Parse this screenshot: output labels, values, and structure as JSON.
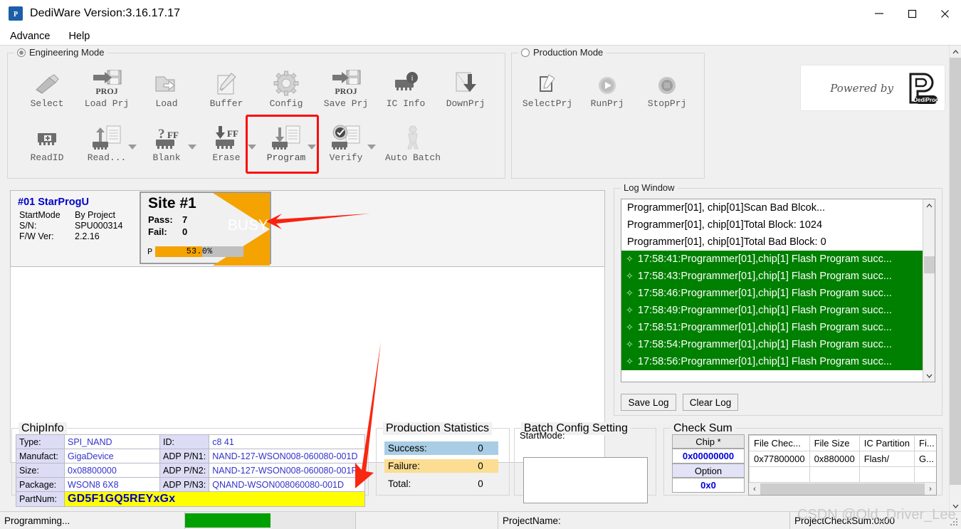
{
  "window": {
    "title": "DediWare  Version:3.16.17.17",
    "app_icon": "P",
    "minimize": "—",
    "maximize": "□",
    "close": "✕"
  },
  "menubar": {
    "items": [
      "Advance",
      "Help"
    ]
  },
  "engineering_mode": {
    "legend": "Engineering Mode",
    "selected": true,
    "buttons": [
      {
        "label": "Select",
        "icon": "select-icon"
      },
      {
        "label": "Load Prj",
        "icon": "load-prj-icon"
      },
      {
        "label": "Load",
        "icon": "load-icon"
      },
      {
        "label": "Buffer",
        "icon": "buffer-icon"
      },
      {
        "label": "Config",
        "icon": "config-gear-icon"
      },
      {
        "label": "Save Prj",
        "icon": "save-prj-icon"
      },
      {
        "label": "IC Info",
        "icon": "ic-info-icon"
      },
      {
        "label": "DownPrj",
        "icon": "down-prj-icon"
      },
      {
        "label": "ReadID",
        "icon": "read-id-icon"
      },
      {
        "label": "Read...",
        "icon": "read-icon"
      },
      {
        "label": "Blank",
        "icon": "blank-check-icon"
      },
      {
        "label": "Erase",
        "icon": "erase-icon"
      },
      {
        "label": "Program",
        "icon": "program-icon"
      },
      {
        "label": "Verify",
        "icon": "verify-icon"
      },
      {
        "label": "Auto Batch",
        "icon": "auto-batch-icon"
      }
    ],
    "highlighted_button": "Program"
  },
  "production_mode": {
    "legend": "Production Mode",
    "selected": false,
    "buttons": [
      {
        "label": "SelectPrj",
        "icon": "select-prj-icon"
      },
      {
        "label": "RunPrj",
        "icon": "run-prj-icon"
      },
      {
        "label": "StopPrj",
        "icon": "stop-prj-icon"
      }
    ]
  },
  "powered_by": {
    "text": "Powered by",
    "logo_text": "DediProg"
  },
  "site_panel": {
    "programmer_title": "#01 StarProgU",
    "rows": [
      {
        "key": "StartMode",
        "value": "By Project"
      },
      {
        "key": "S/N:",
        "value": "SPU000314"
      },
      {
        "key": "F/W Ver:",
        "value": "2.2.16"
      }
    ],
    "site_title": "Site #1",
    "pass_label": "Pass:",
    "pass_value": "7",
    "fail_label": "Fail:",
    "fail_value": "0",
    "progress_prefix": "P",
    "progress_text": "53.0%",
    "progress_percent": 53,
    "status_badge": "BUSY"
  },
  "log_window": {
    "legend": "Log Window",
    "entries": [
      {
        "text": "Programmer[01], chip[01]Scan Bad Blcok...",
        "ok": false
      },
      {
        "text": "Programmer[01], chip[01]Total Block: 1024",
        "ok": false
      },
      {
        "text": "Programmer[01], chip[01]Total Bad Block: 0",
        "ok": false
      },
      {
        "text": "17:58:41:Programmer[01],chip[1] Flash Program succ...",
        "ok": true
      },
      {
        "text": "17:58:43:Programmer[01],chip[1] Flash Program succ...",
        "ok": true
      },
      {
        "text": "17:58:46:Programmer[01],chip[1] Flash Program succ...",
        "ok": true
      },
      {
        "text": "17:58:49:Programmer[01],chip[1] Flash Program succ...",
        "ok": true
      },
      {
        "text": "17:58:51:Programmer[01],chip[1] Flash Program succ...",
        "ok": true
      },
      {
        "text": "17:58:54:Programmer[01],chip[1] Flash Program succ...",
        "ok": true
      },
      {
        "text": "17:58:56:Programmer[01],chip[1] Flash Program succ...",
        "ok": true
      }
    ],
    "save_log": "Save Log",
    "clear_log": "Clear Log",
    "check_glyph": "✧"
  },
  "chip_info": {
    "legend": "ChipInfo",
    "left": [
      {
        "key": "Type:",
        "value": "SPI_NAND"
      },
      {
        "key": "Manufact:",
        "value": "GigaDevice"
      },
      {
        "key": "Size:",
        "value": "0x08800000"
      },
      {
        "key": "Package:",
        "value": "WSON8 6X8"
      }
    ],
    "right": [
      {
        "key": "ID:",
        "value": "c8 41"
      },
      {
        "key": "ADP P/N1:",
        "value": "NAND-127-WSON008-060080-001D"
      },
      {
        "key": "ADP P/N2:",
        "value": "NAND-127-WSON008-060080-001P"
      },
      {
        "key": "ADP P/N3:",
        "value": "QNAND-WSON008060080-001D"
      }
    ],
    "part_key": "PartNum:",
    "part_value": "GD5F1GQ5REYxGx"
  },
  "production_statistics": {
    "legend": "Production Statistics",
    "rows": [
      {
        "key": "Success:",
        "value": "0"
      },
      {
        "key": "Failure:",
        "value": "0"
      },
      {
        "key": "Total:",
        "value": "0"
      }
    ]
  },
  "batch_config": {
    "legend": "Batch Config Setting",
    "start_mode_label": "StartMode:",
    "textarea_value": ""
  },
  "check_sum": {
    "legend": "Check Sum",
    "chip_label": "Chip *",
    "chip_value": "0x00000000",
    "option_label": "Option",
    "option_value": "0x0",
    "table": {
      "headers": [
        "File Chec...",
        "File Size",
        "IC Partition",
        "Fi..."
      ],
      "rows": [
        [
          "0x77800000",
          "0x880000",
          "Flash/",
          "G..."
        ]
      ]
    },
    "scroll_left": "‹",
    "scroll_right": "›"
  },
  "status_bar": {
    "message": "Programming...",
    "progress_percent": 50,
    "project_name_label": "ProjectName:",
    "project_checksum": "ProjectCheckSum:0x00"
  },
  "watermark": "CSDN @Old_Driver_Lee",
  "colors": {
    "accent_orange": "#f5a300",
    "log_success": "#008000",
    "annotation_red": "#fb0d0d",
    "part_highlight": "#ffff00",
    "status_progress": "#00a000"
  }
}
